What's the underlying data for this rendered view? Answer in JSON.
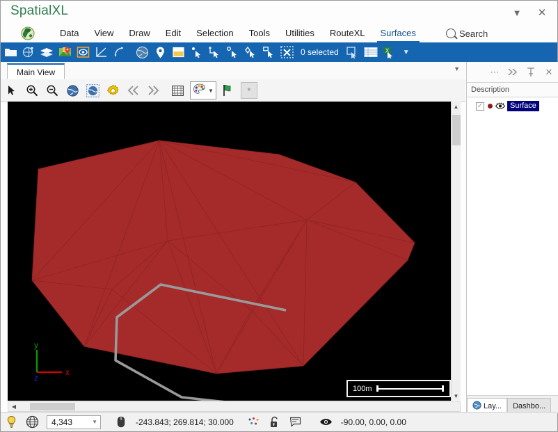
{
  "window": {
    "title": "SpatialXL",
    "dropdown_icon": "chevron-down-icon",
    "close_icon": "close-icon"
  },
  "menu": {
    "logo_icon": "app-logo-icon",
    "items": [
      {
        "label": "Data",
        "active": false
      },
      {
        "label": "View",
        "active": false
      },
      {
        "label": "Draw",
        "active": false
      },
      {
        "label": "Edit",
        "active": false
      },
      {
        "label": "Selection",
        "active": false
      },
      {
        "label": "Tools",
        "active": false
      },
      {
        "label": "Utilities",
        "active": false
      },
      {
        "label": "RouteXL",
        "active": false
      },
      {
        "label": "Surfaces",
        "active": true
      }
    ],
    "search_label": "Search",
    "search_icon": "search-icon"
  },
  "ribbon": {
    "selection_status": "0 selected",
    "overflow_icon": "chevron-down-icon",
    "icons": [
      "open-folder-icon",
      "globe-pin-icon",
      "layers-icon",
      "map-marker-icon",
      "surface-icon",
      "measure-angle-icon",
      "reshape-icon",
      "globe-icon",
      "location-pin-icon",
      "legend-icon",
      "select-point-icon",
      "select-line-icon",
      "select-rectangle-icon",
      "select-circle-icon",
      "select-lasso-icon",
      "select-polygon-icon",
      "clear-selection-icon",
      "copy-selection-icon",
      "table-icon",
      "export-excel-icon"
    ]
  },
  "view_tabs": {
    "tabs": [
      {
        "label": "Main View",
        "active": true
      }
    ],
    "overflow_icon": "chevron-down-icon"
  },
  "view_toolbar": {
    "icons": [
      "pointer-icon",
      "zoom-in-icon",
      "zoom-out-icon",
      "zoom-extents-icon",
      "zoom-selection-icon",
      "view-settings-icon",
      "prev-view-icon",
      "next-view-icon",
      "grid-icon",
      "palette-icon",
      "bookmark-flag-icon",
      "asterisk-icon"
    ],
    "palette_dropdown_icon": "chevron-down-icon",
    "star_label": "*"
  },
  "viewport": {
    "background_color": "#000000",
    "surface_color": "#a52a2a",
    "surface_edge_color": "#8d2422",
    "polyline_color": "#9a9a9a",
    "scale_label": "100m",
    "axes": [
      {
        "name": "x",
        "label": "x",
        "color": "#d40000"
      },
      {
        "name": "y",
        "label": "y",
        "color": "#00a000"
      },
      {
        "name": "z",
        "label": "z",
        "color": "#0000d4"
      }
    ],
    "scroll_up_icon": "chevron-up-icon",
    "scroll_down_icon": "chevron-down-icon",
    "scroll_left_icon": "chevron-left-icon"
  },
  "right_panel": {
    "more_icon": "ellipsis-icon",
    "expand_icon": "double-chevron-right-icon",
    "pin_icon": "pin-icon",
    "close_icon": "close-icon",
    "column_header": "Description",
    "items": [
      {
        "label": "Surface",
        "checked": true,
        "color": "#8e1b1b",
        "visibility_icon": "eye-icon",
        "selected": true
      }
    ],
    "tabs": [
      {
        "label": "Lay...",
        "icon": "globe-icon",
        "active": true
      },
      {
        "label": "Dashbo...",
        "icon": "",
        "active": false
      }
    ]
  },
  "status_bar": {
    "tip_icon": "lightbulb-icon",
    "wireframe_icon": "wireframe-globe-icon",
    "zoom_value": "4,343",
    "zoom_dropdown_icon": "chevron-down-icon",
    "mouse_icon": "mouse-icon",
    "coordinates": "-243.843; 269.814; 30.000",
    "snap_icon": "snap-points-icon",
    "lock_icon": "unlock-icon",
    "note_icon": "note-icon",
    "eye_icon": "eye-icon",
    "view_angles": "-90.00, 0.00, 0.00"
  }
}
